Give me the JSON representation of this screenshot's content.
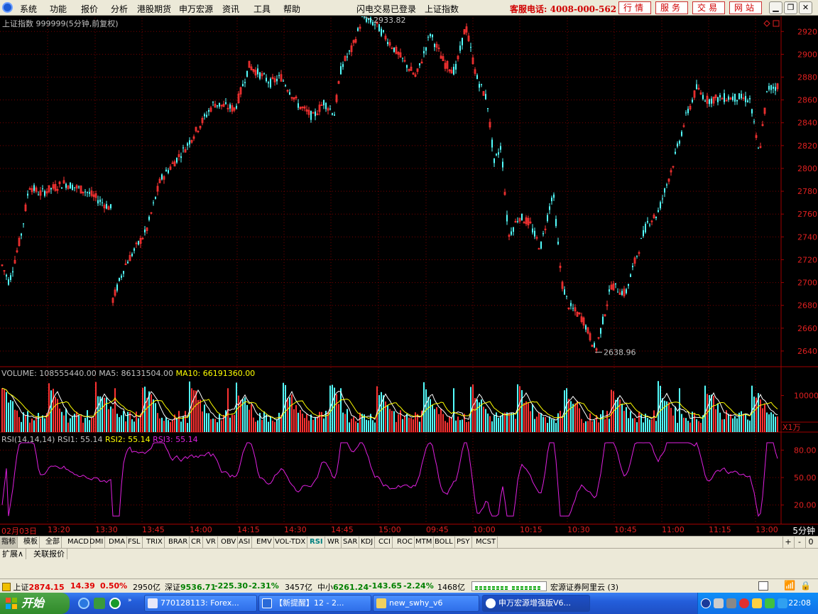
{
  "menu": {
    "items": [
      "系统",
      "功能",
      "报价",
      "分析",
      "港股期货",
      "申万宏源",
      "资讯",
      "工具",
      "帮助"
    ],
    "center_status": [
      "闪电交易已登录",
      "上证指数"
    ],
    "hotline": "客服电话: 4008-000-562",
    "buttons": [
      "行情",
      "服务",
      "交易",
      "网站"
    ]
  },
  "price_panel": {
    "title": "上证指数 999999(5分钟,前复权)",
    "high_label": "2933.82",
    "low_label": "2638.96",
    "y_ticks": [
      "2920",
      "2900",
      "2880",
      "2860",
      "2840",
      "2820",
      "2800",
      "2780",
      "2760",
      "2740",
      "2720",
      "2700",
      "2680",
      "2660",
      "2640"
    ],
    "up_color": "#ff3333",
    "down_color": "#54ffff"
  },
  "volume_panel": {
    "label": "VOLUME:",
    "volume": "108555440.00",
    "ma5_label": "MA5:",
    "ma5": "86131504.00",
    "ma10_label": "MA10:",
    "ma10": "66191360.00",
    "y_tick": "10000",
    "unit": "X1万"
  },
  "rsi_panel": {
    "label": "RSI(14,14,14)",
    "rsi1": "RSI1: 55.14",
    "rsi2": "RSI2: 55.14",
    "rsi3": "RSI3: 55.14",
    "y_ticks": [
      "80.00",
      "50.00",
      "20.00"
    ],
    "line_color": "#e020e0"
  },
  "time_axis": {
    "ticks": [
      "02月03日",
      "13:20",
      "13:30",
      "13:45",
      "14:00",
      "14:15",
      "14:30",
      "14:45",
      "15:00",
      "09:45",
      "10:00",
      "10:15",
      "10:30",
      "10:45",
      "11:00",
      "11:15",
      "13:00"
    ],
    "period": "5分钟"
  },
  "indicator_tabs": [
    "指标",
    "模板",
    "全部",
    "MACD",
    "DMI",
    "DMA",
    "FSL",
    "TRIX",
    "BRAR",
    "CR",
    "VR",
    "OBV",
    "ASI",
    "EMV",
    "VOL-TDX",
    "RSI",
    "WR",
    "SAR",
    "KDJ",
    "CCI",
    "ROC",
    "MTM",
    "BOLL",
    "PSY",
    "MCST"
  ],
  "indicator_controls": [
    "+",
    "-",
    "0"
  ],
  "expand_bar": [
    "扩展∧",
    "关联报价"
  ],
  "index_bar": {
    "sh_label": "上证",
    "sh_value": "2874.15",
    "sh_change": "14.39",
    "sh_pct": "0.50%",
    "sh_amount": "2950亿",
    "sz_label": "深证",
    "sz_value": "9536.71",
    "sz_change": "-225.30",
    "sz_pct": "-2.31%",
    "sz_amount": "3457亿",
    "zx_label": "中小",
    "zx_value": "6261.24",
    "zx_change": "-143.65",
    "zx_pct": "-2.24%",
    "zx_amount": "1468亿",
    "broker": "宏源证券阿里云 (3)"
  },
  "taskbar": {
    "start": "开始",
    "tasks": [
      "770128113: Forex...",
      "【新提醒】12 - 2...",
      "new_swhy_v6",
      "申万宏源增强版V6..."
    ],
    "clock": "22:08"
  }
}
